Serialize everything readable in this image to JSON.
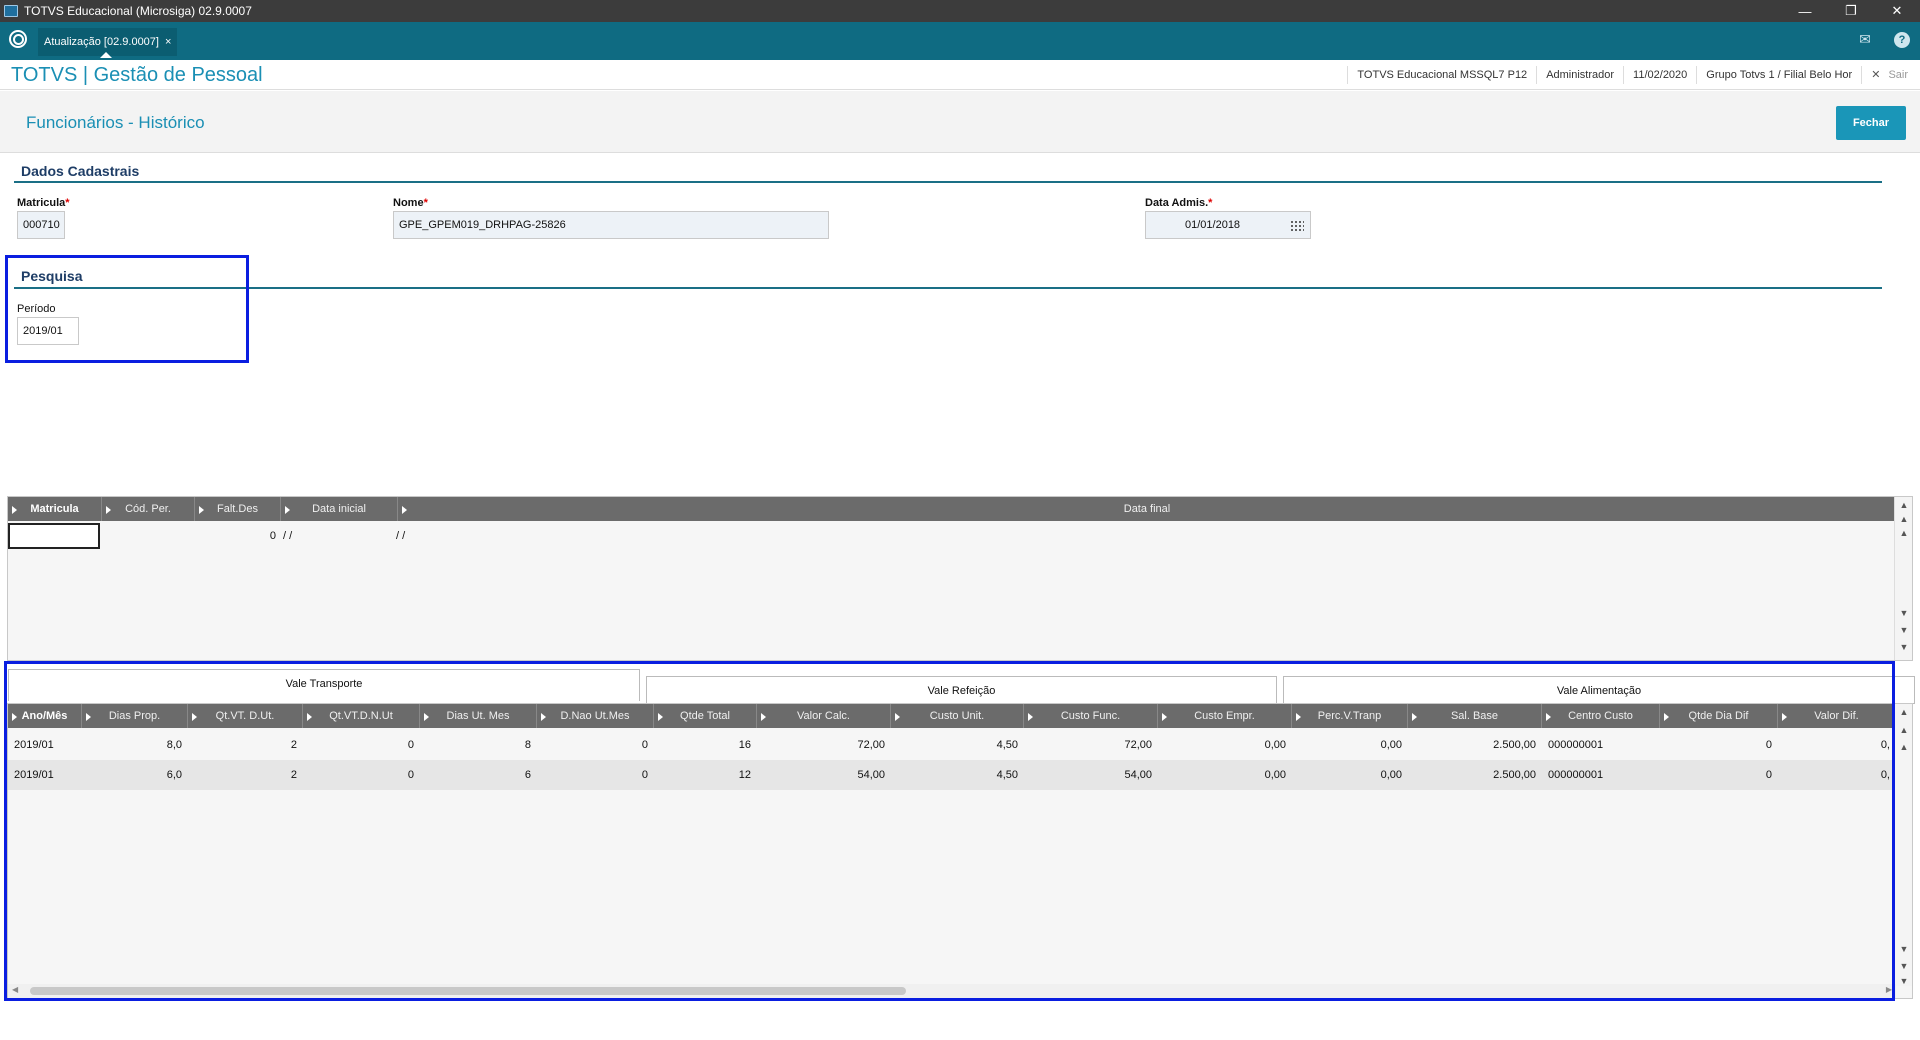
{
  "window": {
    "title": "TOTVS Educacional (Microsiga) 02.9.0007",
    "minimize": "—",
    "restore": "❐",
    "close": "✕"
  },
  "tabbar": {
    "active_tab": "Atualização [02.9.0007]",
    "tab_close": "×",
    "mail_icon": "✉",
    "help_icon": "?"
  },
  "header": {
    "brand": "TOTVS | Gestão de Pessoal",
    "database": "TOTVS Educacional MSSQL7 P12",
    "user": "Administrador",
    "date": "11/02/2020",
    "company": "Grupo Totvs 1 / Filial Belo Hor",
    "exit_icon": "✕",
    "exit_label": "Sair"
  },
  "page": {
    "title": "Funcionários - Histórico",
    "close_button": "Fechar"
  },
  "dados_cadastrais": {
    "section_title": "Dados Cadastrais",
    "matricula_label": "Matricula",
    "matricula_value": "000710",
    "nome_label": "Nome",
    "nome_value": "GPE_GPEM019_DRHPAG-25826",
    "data_admis_label": "Data Admis.",
    "data_admis_value": "01/01/2018",
    "required_mark": "*"
  },
  "pesquisa": {
    "section_title": "Pesquisa",
    "periodo_label": "Período",
    "periodo_value": "2019/01"
  },
  "upper_grid": {
    "columns": [
      "Matricula",
      "Cód. Per.",
      "Falt.Des",
      "Data inicial",
      "Data final"
    ],
    "row": {
      "matricula": "",
      "cod_per": "",
      "falt_des": "0",
      "data_inicial": "/ /",
      "data_final": "/ /"
    }
  },
  "tabs": [
    "Vale Transporte",
    "Vale Refeição",
    "Vale Alimentação"
  ],
  "lower_grid": {
    "columns": [
      "Ano/Mês",
      "Dias Prop.",
      "Qt.VT. D.Ut.",
      "Qt.VT.D.N.Ut",
      "Dias Ut. Mes",
      "D.Nao Ut.Mes",
      "Qtde Total",
      "Valor Calc.",
      "Custo Unit.",
      "Custo Func.",
      "Custo Empr.",
      "Perc.V.Tranp",
      "Sal. Base",
      "Centro Custo",
      "Qtde Dia Dif",
      "Valor Dif."
    ],
    "rows": [
      [
        "2019/01",
        "8,0",
        "2",
        "0",
        "8",
        "0",
        "16",
        "72,00",
        "4,50",
        "72,00",
        "0,00",
        "0,00",
        "2.500,00",
        "000000001",
        "0",
        "0,"
      ],
      [
        "2019/01",
        "6,0",
        "2",
        "0",
        "6",
        "0",
        "12",
        "54,00",
        "4,50",
        "54,00",
        "0,00",
        "0,00",
        "2.500,00",
        "000000001",
        "0",
        "0,"
      ]
    ]
  },
  "scroll_glyphs": {
    "top": "⤒",
    "pgup": "⇞",
    "up": "▲",
    "down": "▼",
    "pgdn": "⇟",
    "bottom": "⤓",
    "left": "◀",
    "right": "▶"
  }
}
